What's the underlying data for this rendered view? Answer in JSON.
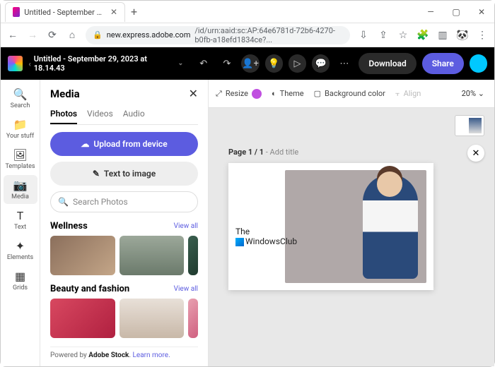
{
  "browser": {
    "tab_title": "Untitled - September 29, 2023 a",
    "url_prefix": "new.express.adobe.com",
    "url_rest": "/id/urn:aaid:sc:AP:64e6781d-72b6-4270-b0fb-a18efd1834ce?..."
  },
  "appbar": {
    "doc_title": "Untitled - September 29, 2023 at 18.14.43",
    "download": "Download",
    "share": "Share"
  },
  "rail": [
    {
      "label": "Search"
    },
    {
      "label": "Your stuff"
    },
    {
      "label": "Templates"
    },
    {
      "label": "Media"
    },
    {
      "label": "Text"
    },
    {
      "label": "Elements"
    },
    {
      "label": "Grids"
    }
  ],
  "panel": {
    "title": "Media",
    "tabs": [
      "Photos",
      "Videos",
      "Audio"
    ],
    "upload": "Upload from device",
    "text_to_image": "Text to image",
    "search_placeholder": "Search Photos",
    "sections": [
      {
        "title": "Wellness",
        "viewall": "View all"
      },
      {
        "title": "Beauty and fashion",
        "viewall": "View all"
      }
    ],
    "powered_prefix": "Powered by ",
    "powered_brand": "Adobe Stock",
    "powered_dot": ". ",
    "powered_link": "Learn more."
  },
  "canvas": {
    "resize": "Resize",
    "theme": "Theme",
    "bgcolor": "Background color",
    "align": "Align",
    "zoom": "20%",
    "page_label": "Page 1 / 1",
    "page_sub": " - Add title",
    "watermark1": "The",
    "watermark2": "WindowsClub"
  }
}
